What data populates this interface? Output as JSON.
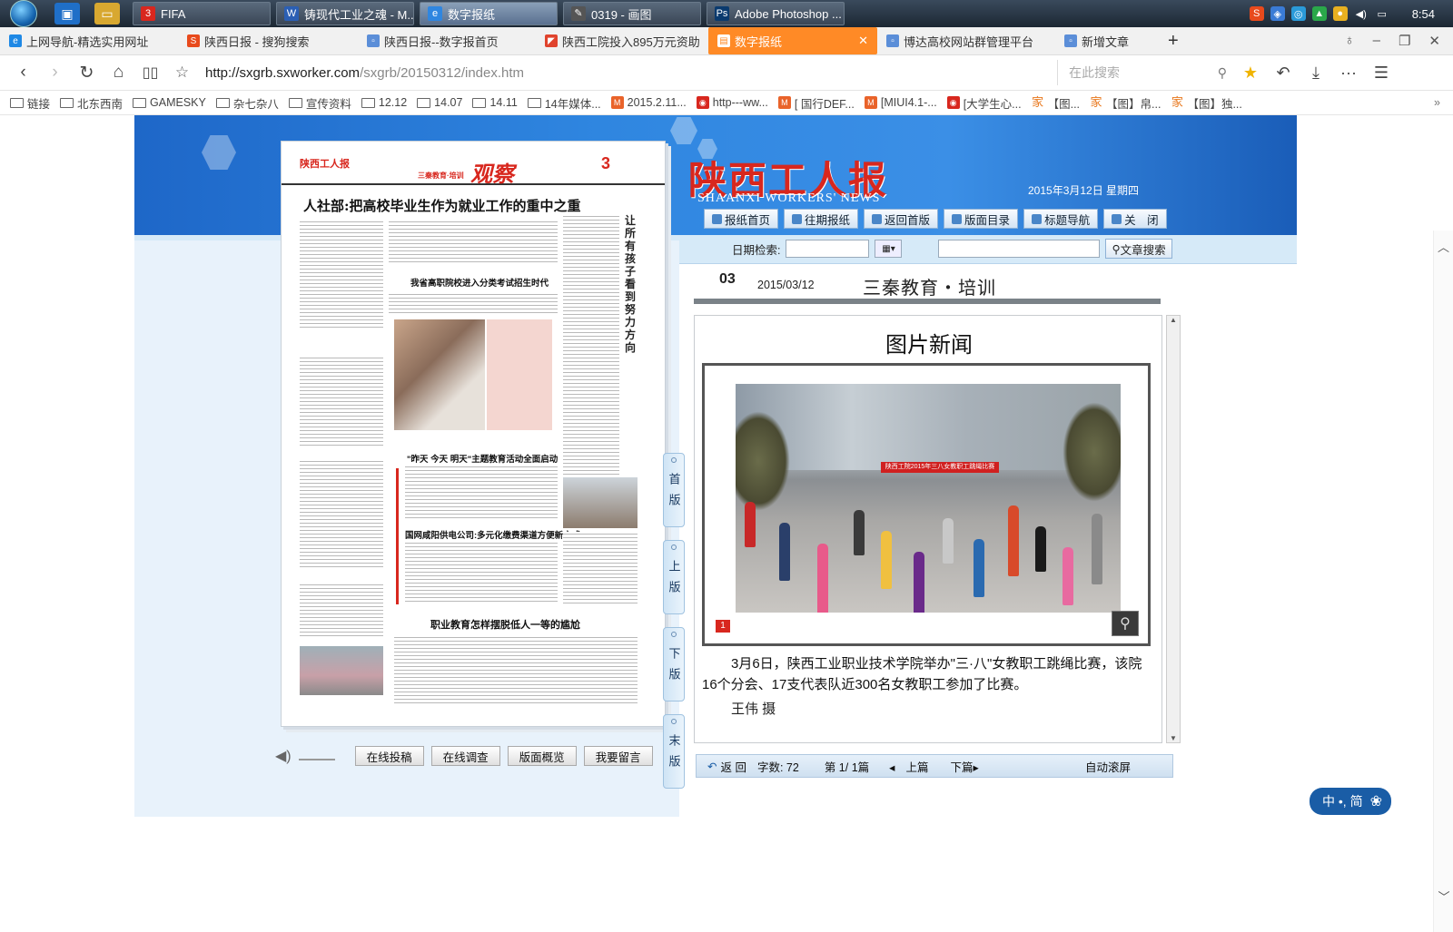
{
  "taskbar": {
    "items": [
      {
        "label": "FIFA",
        "badge": "3",
        "color": "#d8271e"
      },
      {
        "label": "铸现代工业之魂 - M...",
        "badge": "W",
        "color": "#2b5fb4"
      },
      {
        "label": "数字报纸",
        "badge": "e",
        "color": "#2f86e0"
      },
      {
        "label": "0319 - 画图",
        "badge": "✎",
        "color": "#555"
      },
      {
        "label": "Adobe Photoshop ...",
        "badge": "Ps",
        "color": "#0a3a6e"
      }
    ],
    "clock": "8:54"
  },
  "tabs": [
    {
      "label": "上网导航-精选实用网址",
      "color": "#1e88e5",
      "glyph": "e"
    },
    {
      "label": "陕西日报 - 搜狗搜索",
      "color": "#e84a1c",
      "glyph": "S"
    },
    {
      "label": "陕西日报--数字报首页",
      "color": "#5b8ed8",
      "glyph": "▫"
    },
    {
      "label": "陕西工院投入895万元资助",
      "color": "#e0432d",
      "glyph": "◤"
    },
    {
      "label": "数字报纸",
      "color": "#ff8a26",
      "glyph": "▤",
      "active": true
    },
    {
      "label": "博达高校网站群管理平台",
      "color": "#5b8ed8",
      "glyph": "▫"
    },
    {
      "label": "新增文章",
      "color": "#5b8ed8",
      "glyph": "▫"
    }
  ],
  "address": {
    "url_main": "http://sxgrb.sxworker.com",
    "url_rest": "/sxgrb/20150312/index.htm",
    "search_placeholder": "在此搜索"
  },
  "bookmarks": [
    {
      "label": "链接",
      "type": "folder"
    },
    {
      "label": "北东西南",
      "type": "folder"
    },
    {
      "label": "GAMESKY",
      "type": "folder"
    },
    {
      "label": "杂七杂八",
      "type": "folder"
    },
    {
      "label": "宣传资料",
      "type": "folder"
    },
    {
      "label": "12.12",
      "type": "folder"
    },
    {
      "label": "14.07",
      "type": "folder"
    },
    {
      "label": "14.11",
      "type": "folder"
    },
    {
      "label": "14年媒体...",
      "type": "folder"
    },
    {
      "label": "2015.2.11...",
      "type": "miui"
    },
    {
      "label": "http---ww...",
      "type": "site"
    },
    {
      "label": "[ 国行DEF...",
      "type": "miui"
    },
    {
      "label": "[MIUI4.1-...",
      "type": "miui"
    },
    {
      "label": "[大学生心...",
      "type": "site"
    },
    {
      "label": "【图...",
      "type": "jia"
    },
    {
      "label": "【图】帛...",
      "type": "jia"
    },
    {
      "label": "【图】独...",
      "type": "jia"
    }
  ],
  "page": {
    "masthead": "陕西工人报",
    "masthead_en": "SHAANXI WORKERS' NEWS",
    "date": "2015年3月12日 星期四",
    "nav": [
      "报纸首页",
      "往期报纸",
      "返回首版",
      "版面目录",
      "标题导航",
      "关　闭"
    ],
    "search": {
      "date_label": "日期检索:",
      "article_search": "文章搜索"
    },
    "paper": {
      "section": "三秦教育·培训",
      "column": "观察",
      "page_no": "3",
      "headline": "人社部:把高校毕业生作为就业工作的重中之重",
      "sub1": "我省高职院校进入分类考试招生时代",
      "sub2": "\"昨天 今天 明天\"主题教育活动全面启动",
      "sub3": "国网咸阳供电公司:多元化缴费渠道方便新方式",
      "sub4": "职业教育怎样摆脱低人一等的尴尬",
      "side_quote": "让所有孩子看到努力方向"
    },
    "side_tabs": [
      "首版",
      "上版",
      "下版",
      "末版"
    ],
    "bottom_buttons": [
      "在线投稿",
      "在线调查",
      "版面概览",
      "我要留言"
    ],
    "article": {
      "page_num": "03",
      "page_date": "2015/03/12",
      "section": "三秦教育・培训",
      "title": "图片新闻",
      "photo_banner": "陕西工院2015年三八女教职工跳绳比赛",
      "photo_index": "1",
      "caption": "3月6日，陕西工业职业技术学院举办\"三·八\"女教职工跳绳比赛，该院16个分会、17支代表队近300名女教职工参加了比赛。",
      "byline": "王伟 摄"
    },
    "footer": {
      "back": "返 回",
      "chars": "字数: 72",
      "count": "第 1/ 1篇",
      "prev": "上篇",
      "next": "下篇",
      "autoscroll": "自动滚屏"
    }
  },
  "ime": "中 •, 简"
}
